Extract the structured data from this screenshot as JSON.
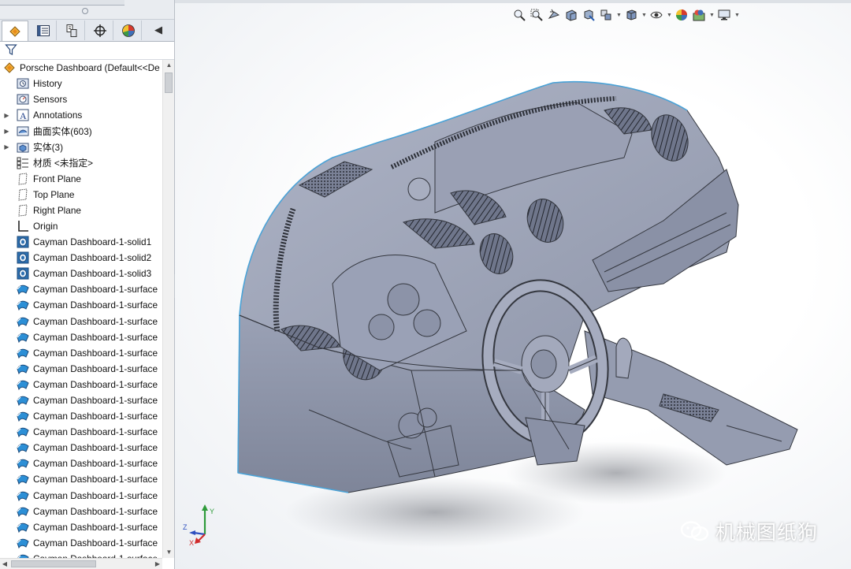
{
  "tabs": [
    {
      "id": "feature-manager",
      "icon": "feature-manager-icon"
    },
    {
      "id": "property-manager",
      "icon": "property-manager-icon"
    },
    {
      "id": "configuration-manager",
      "icon": "configuration-manager-icon"
    },
    {
      "id": "dimxpert-manager",
      "icon": "crosshair-icon"
    },
    {
      "id": "display-manager",
      "icon": "appearance-pie-icon"
    }
  ],
  "tree": {
    "root": "Porsche Dashboard  (Default<<De",
    "items": [
      {
        "label": "History",
        "icon": "history-icon",
        "expandable": false
      },
      {
        "label": "Sensors",
        "icon": "sensors-icon",
        "expandable": false
      },
      {
        "label": "Annotations",
        "icon": "annotations-icon",
        "expandable": true
      },
      {
        "label": "曲面实体(603)",
        "icon": "surface-bodies-folder-icon",
        "expandable": true
      },
      {
        "label": "实体(3)",
        "icon": "solid-bodies-folder-icon",
        "expandable": true
      },
      {
        "label": "材质 <未指定>",
        "icon": "material-icon",
        "expandable": false
      },
      {
        "label": "Front Plane",
        "icon": "plane-icon",
        "expandable": false
      },
      {
        "label": "Top Plane",
        "icon": "plane-icon",
        "expandable": false
      },
      {
        "label": "Right Plane",
        "icon": "plane-icon",
        "expandable": false
      },
      {
        "label": "Origin",
        "icon": "origin-icon",
        "expandable": false
      },
      {
        "label": "Cayman Dashboard-1-solid1",
        "icon": "imported-solid-icon",
        "expandable": false
      },
      {
        "label": "Cayman Dashboard-1-solid2",
        "icon": "imported-solid-icon",
        "expandable": false
      },
      {
        "label": "Cayman Dashboard-1-solid3",
        "icon": "imported-solid-icon",
        "expandable": false
      },
      {
        "label": "Cayman Dashboard-1-surface",
        "icon": "imported-surface-icon",
        "expandable": false
      },
      {
        "label": "Cayman Dashboard-1-surface",
        "icon": "imported-surface-icon",
        "expandable": false
      },
      {
        "label": "Cayman Dashboard-1-surface",
        "icon": "imported-surface-icon",
        "expandable": false
      },
      {
        "label": "Cayman Dashboard-1-surface",
        "icon": "imported-surface-icon",
        "expandable": false
      },
      {
        "label": "Cayman Dashboard-1-surface",
        "icon": "imported-surface-icon",
        "expandable": false
      },
      {
        "label": "Cayman Dashboard-1-surface",
        "icon": "imported-surface-icon",
        "expandable": false
      },
      {
        "label": "Cayman Dashboard-1-surface",
        "icon": "imported-surface-icon",
        "expandable": false
      },
      {
        "label": "Cayman Dashboard-1-surface",
        "icon": "imported-surface-icon",
        "expandable": false
      },
      {
        "label": "Cayman Dashboard-1-surface",
        "icon": "imported-surface-icon",
        "expandable": false
      },
      {
        "label": "Cayman Dashboard-1-surface",
        "icon": "imported-surface-icon",
        "expandable": false
      },
      {
        "label": "Cayman Dashboard-1-surface",
        "icon": "imported-surface-icon",
        "expandable": false
      },
      {
        "label": "Cayman Dashboard-1-surface",
        "icon": "imported-surface-icon",
        "expandable": false
      },
      {
        "label": "Cayman Dashboard-1-surface",
        "icon": "imported-surface-icon",
        "expandable": false
      },
      {
        "label": "Cayman Dashboard-1-surface",
        "icon": "imported-surface-icon",
        "expandable": false
      },
      {
        "label": "Cayman Dashboard-1-surface",
        "icon": "imported-surface-icon",
        "expandable": false
      },
      {
        "label": "Cayman Dashboard-1-surface",
        "icon": "imported-surface-icon",
        "expandable": false
      },
      {
        "label": "Cayman Dashboard-1-surface",
        "icon": "imported-surface-icon",
        "expandable": false
      },
      {
        "label": "Cayman Dashboard-1-surface",
        "icon": "imported-surface-icon",
        "expandable": false
      },
      {
        "label": "Cayman Dashboard-1-surface",
        "icon": "imported-surface-icon",
        "expandable": false
      }
    ]
  },
  "heads_up_toolbar": [
    {
      "icon": "zoom-to-fit-icon",
      "dropdown": false
    },
    {
      "icon": "zoom-to-area-icon",
      "dropdown": false
    },
    {
      "icon": "previous-view-icon",
      "dropdown": false
    },
    {
      "icon": "section-view-icon",
      "dropdown": false
    },
    {
      "icon": "dynamic-annotation-views-icon",
      "dropdown": false
    },
    {
      "icon": "view-orientation-icon",
      "dropdown": true
    },
    {
      "icon": "display-style-icon",
      "dropdown": true
    },
    {
      "icon": "hide-show-items-icon",
      "dropdown": true
    },
    {
      "icon": "edit-appearance-icon",
      "dropdown": false
    },
    {
      "icon": "apply-scene-icon",
      "dropdown": true
    },
    {
      "icon": "view-settings-icon",
      "dropdown": true
    }
  ],
  "triad": {
    "y": "Y",
    "x": "X",
    "z": "Z"
  },
  "watermark": {
    "text": "机械图纸狗",
    "icon": "wechat-icon"
  },
  "colors": {
    "model_fill": "#9ea5b7",
    "model_edge": "#34373f",
    "model_silhouette": "#4aa3d8",
    "panel_bg": "#ffffff",
    "tabbar_bg": "#e4e8ee"
  }
}
